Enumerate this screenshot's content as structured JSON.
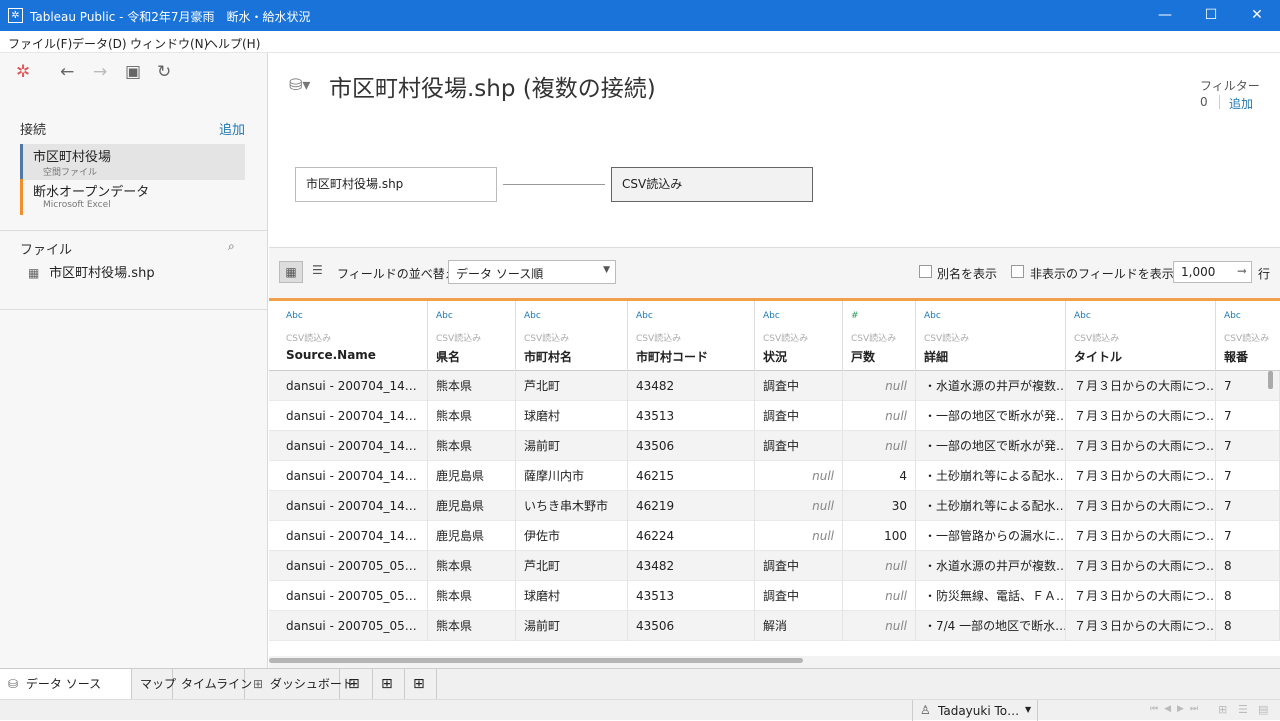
{
  "window": {
    "title": "Tableau Public - 令和2年7月豪雨　断水・給水状況",
    "app_icon": "tableau-icon"
  },
  "menu": [
    "ファイル(F)",
    "データ(D)",
    "ウィンドウ(N)",
    "ヘルプ(H)"
  ],
  "sidebar": {
    "connections_label": "接続",
    "add_label": "追加",
    "connections": [
      {
        "name": "市区町村役場",
        "type": "空間ファイル",
        "color": "#4e79a7"
      },
      {
        "name": "断水オープンデータ",
        "type": "Microsoft Excel",
        "color": "#f28e2b"
      }
    ],
    "files_label": "ファイル",
    "files": [
      {
        "name": "市区町村役場.shp"
      }
    ]
  },
  "canvas": {
    "title": "市区町村役場.shp (複数の接続)",
    "filter_label": "フィルター",
    "filter_count": "0",
    "filter_add": "追加",
    "left_table": "市区町村役場.shp",
    "right_table": "CSV読込み"
  },
  "grid_toolbar": {
    "sort_label": "フィールドの並べ替え",
    "sort_value": "データ ソース順",
    "alias_label": "別名を表示",
    "hidden_label": "非表示のフィールドを表示",
    "rows_value": "1,000",
    "rows_suffix": "行"
  },
  "columns": [
    {
      "type": "Abc",
      "src": "CSV読込み",
      "name": "Source.Name"
    },
    {
      "type": "Abc",
      "src": "CSV読込み",
      "name": "県名"
    },
    {
      "type": "Abc",
      "src": "CSV読込み",
      "name": "市町村名"
    },
    {
      "type": "Abc",
      "src": "CSV読込み",
      "name": "市町村コード"
    },
    {
      "type": "Abc",
      "src": "CSV読込み",
      "name": "状況"
    },
    {
      "type": "#",
      "src": "CSV読込み",
      "name": "戸数"
    },
    {
      "type": "Abc",
      "src": "CSV読込み",
      "name": "詳細"
    },
    {
      "type": "Abc",
      "src": "CSV読込み",
      "name": "タイトル"
    },
    {
      "type": "Abc",
      "src": "CSV読込み",
      "name": "報番"
    }
  ],
  "rows": [
    [
      "dansui - 200704_14…",
      "熊本県",
      "芦北町",
      "43482",
      "調査中",
      "null",
      "・水道水源の井戸が複数…",
      "７月３日からの大雨につ…",
      "7"
    ],
    [
      "dansui - 200704_14…",
      "熊本県",
      "球磨村",
      "43513",
      "調査中",
      "null",
      "・一部の地区で断水が発…",
      "７月３日からの大雨につ…",
      "7"
    ],
    [
      "dansui - 200704_14…",
      "熊本県",
      "湯前町",
      "43506",
      "調査中",
      "null",
      "・一部の地区で断水が発…",
      "７月３日からの大雨につ…",
      "7"
    ],
    [
      "dansui - 200704_14…",
      "鹿児島県",
      "薩摩川内市",
      "46215",
      "null",
      "4",
      "・土砂崩れ等による配水…",
      "７月３日からの大雨につ…",
      "7"
    ],
    [
      "dansui - 200704_14…",
      "鹿児島県",
      "いちき串木野市",
      "46219",
      "null",
      "30",
      "・土砂崩れ等による配水…",
      "７月３日からの大雨につ…",
      "7"
    ],
    [
      "dansui - 200704_14…",
      "鹿児島県",
      "伊佐市",
      "46224",
      "null",
      "100",
      "・一部管路からの漏水に…",
      "７月３日からの大雨につ…",
      "7"
    ],
    [
      "dansui - 200705_05…",
      "熊本県",
      "芦北町",
      "43482",
      "調査中",
      "null",
      "・水道水源の井戸が複数…",
      "７月３日からの大雨につ…",
      "8"
    ],
    [
      "dansui - 200705_05…",
      "熊本県",
      "球磨村",
      "43513",
      "調査中",
      "null",
      "・防災無線、電話、ＦＡ…",
      "７月３日からの大雨につ…",
      "8"
    ],
    [
      "dansui - 200705_05…",
      "熊本県",
      "湯前町",
      "43506",
      "解消",
      "null",
      "・7/4 一部の地区で断水…",
      "７月３日からの大雨につ…",
      "8"
    ]
  ],
  "tabs": [
    "データ ソース",
    "マップ",
    "タイムライン",
    "ダッシュボード"
  ],
  "status": {
    "user": "Tadayuki To…"
  }
}
